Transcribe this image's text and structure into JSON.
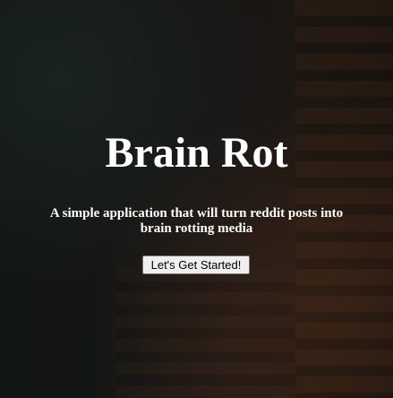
{
  "hero": {
    "title": "Brain Rot",
    "subtitle": "A simple application that will turn reddit posts into brain rotting media",
    "cta_label": "Let's Get Started!"
  },
  "colors": {
    "text": "#ffffff",
    "background": "#151515",
    "button_bg": "#efefef",
    "button_border": "#767676"
  }
}
